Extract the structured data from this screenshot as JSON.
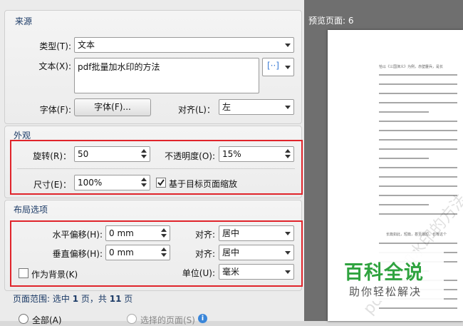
{
  "source": {
    "title": "来源",
    "type_label": "类型(T):",
    "type_value": "文本",
    "text_label": "文本(X):",
    "text_value": "pdf批量加水印的方法",
    "insert_icon": "[··]",
    "font_label": "字体(F):",
    "font_button": "字体(F)...",
    "align_label": "对齐(L)：",
    "align_value": "左"
  },
  "appearance": {
    "title": "外观",
    "rotation_label": "旋转(R)：",
    "rotation_value": "50",
    "opacity_label": "不透明度(O):",
    "opacity_value": "15%",
    "size_label": "尺寸(E)：",
    "size_value": "100%",
    "relative_label": "基于目标页面缩放"
  },
  "layout": {
    "title": "布局选项",
    "h_offset_label": "水平偏移(H):",
    "h_offset_value": "0 mm",
    "h_align_label": "对齐:",
    "h_align_value": "居中",
    "v_offset_label": "垂直偏移(H):",
    "v_offset_value": "0 mm",
    "v_align_label": "对齐:",
    "v_align_value": "居中",
    "background_label": "作为背景(K)",
    "unit_label": "单位(U):",
    "unit_value": "毫米"
  },
  "page_range": {
    "text_prefix": "页面范围: 选中",
    "selected": "1",
    "text_mid": "页，共",
    "total": "11",
    "text_suffix": "页",
    "all_label": "全部(A)",
    "selected_label": "选择的页面(S)"
  },
  "preview": {
    "title": "预览页面: 6",
    "first_line": "恰以《三国演义》为例，赤壁鏖兵，是长",
    "para2_line": "长篇如此，短篇，甚至最短，也有这个"
  },
  "watermark": {
    "big": "百科全说",
    "small": "助你轻松解决"
  },
  "colors": {
    "highlight": "#e0242b",
    "section_title": "#1b3a66",
    "preview_bg": "#6f6f6f",
    "watermark_green": "#2fa33f"
  }
}
